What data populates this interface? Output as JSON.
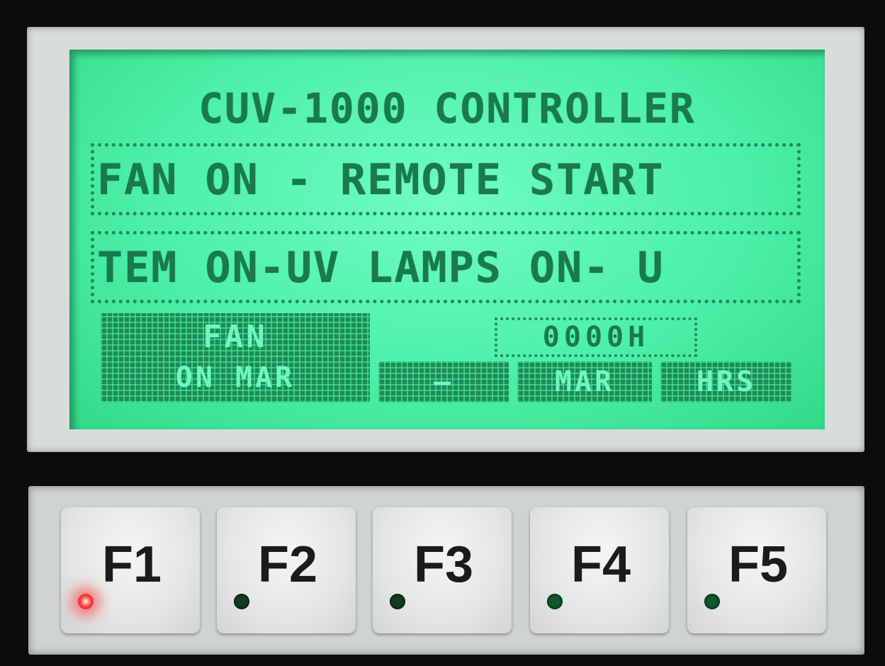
{
  "display": {
    "title": "CUV-1000 CONTROLLER",
    "status_line_1": "FAN ON - REMOTE START",
    "status_line_2": "TEM ON-UV LAMPS ON- U",
    "softkey_fan": {
      "line1": "FAN",
      "line2": "ON MAR"
    },
    "softkey_dash": "—",
    "counter": "0000H",
    "softkey_mar": "MAR",
    "softkey_hrs": "HRS"
  },
  "keys": [
    {
      "label": "F1",
      "led": "red-on"
    },
    {
      "label": "F2",
      "led": "green-off"
    },
    {
      "label": "F3",
      "led": "green-off"
    },
    {
      "label": "F4",
      "led": "green-dim"
    },
    {
      "label": "F5",
      "led": "green-dim"
    }
  ],
  "colors": {
    "lcd_background": "#4cf0a8",
    "lcd_text": "#1a7a4c",
    "led_active": "#ff3030",
    "led_inactive": "#113d22"
  }
}
